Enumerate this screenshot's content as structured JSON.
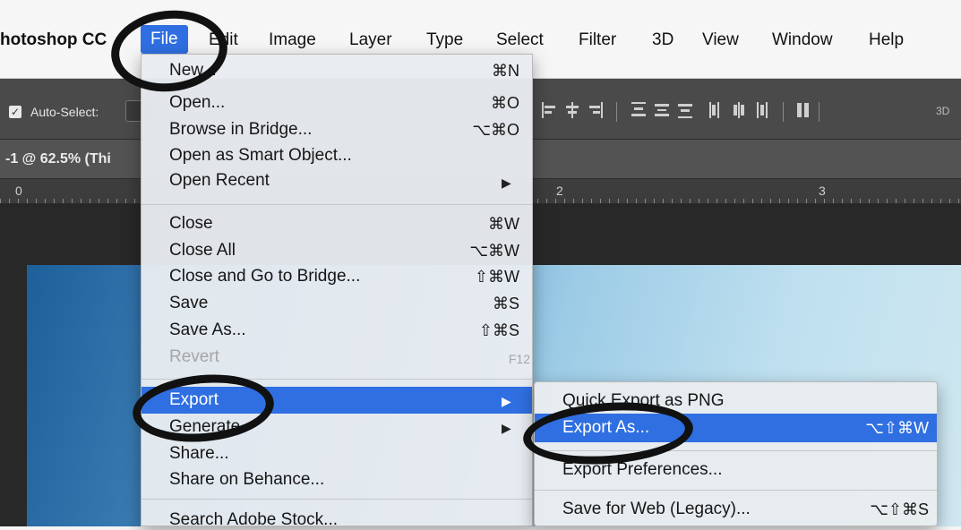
{
  "menubar": {
    "app_name": "hotoshop CC",
    "items": [
      "File",
      "Edit",
      "Image",
      "Layer",
      "Type",
      "Select",
      "Filter",
      "3D",
      "View",
      "Window",
      "Help"
    ]
  },
  "options_bar": {
    "auto_select_label": "Auto-Select:",
    "auto_select_checked": true,
    "threed_label": "3D"
  },
  "document": {
    "tab_label": "-1 @ 62.5% (Thi"
  },
  "ruler": {
    "marks": [
      "0",
      "2",
      "3"
    ]
  },
  "file_menu": {
    "items": [
      {
        "label": "New...",
        "shortcut": "⌘N"
      },
      {
        "label": "Open...",
        "shortcut": "⌘O"
      },
      {
        "label": "Browse in Bridge...",
        "shortcut": "⌥⌘O"
      },
      {
        "label": "Open as Smart Object...",
        "shortcut": ""
      },
      {
        "label": "Open Recent",
        "shortcut": "",
        "submenu": true
      },
      {
        "label": "Close",
        "shortcut": "⌘W"
      },
      {
        "label": "Close All",
        "shortcut": "⌥⌘W"
      },
      {
        "label": "Close and Go to Bridge...",
        "shortcut": "⇧⌘W"
      },
      {
        "label": "Save",
        "shortcut": "⌘S"
      },
      {
        "label": "Save As...",
        "shortcut": "⇧⌘S"
      },
      {
        "label": "Revert",
        "shortcut": "F12",
        "disabled": true
      },
      {
        "label": "Export",
        "shortcut": "",
        "submenu": true,
        "highlighted": true
      },
      {
        "label": "Generate",
        "shortcut": "",
        "submenu": true
      },
      {
        "label": "Share...",
        "shortcut": ""
      },
      {
        "label": "Share on Behance...",
        "shortcut": ""
      },
      {
        "label": "Search Adobe Stock...",
        "shortcut": ""
      }
    ]
  },
  "export_submenu": {
    "items": [
      {
        "label": "Quick Export as PNG",
        "shortcut": ""
      },
      {
        "label": "Export As...",
        "shortcut": "⌥⇧⌘W",
        "highlighted": true
      },
      {
        "label": "Export Preferences...",
        "shortcut": ""
      },
      {
        "label": "Save for Web (Legacy)...",
        "shortcut": "⌥⇧⌘S"
      }
    ]
  },
  "colors": {
    "menu_highlight": "#2f6fe1",
    "annotation_circle": "#111111"
  }
}
